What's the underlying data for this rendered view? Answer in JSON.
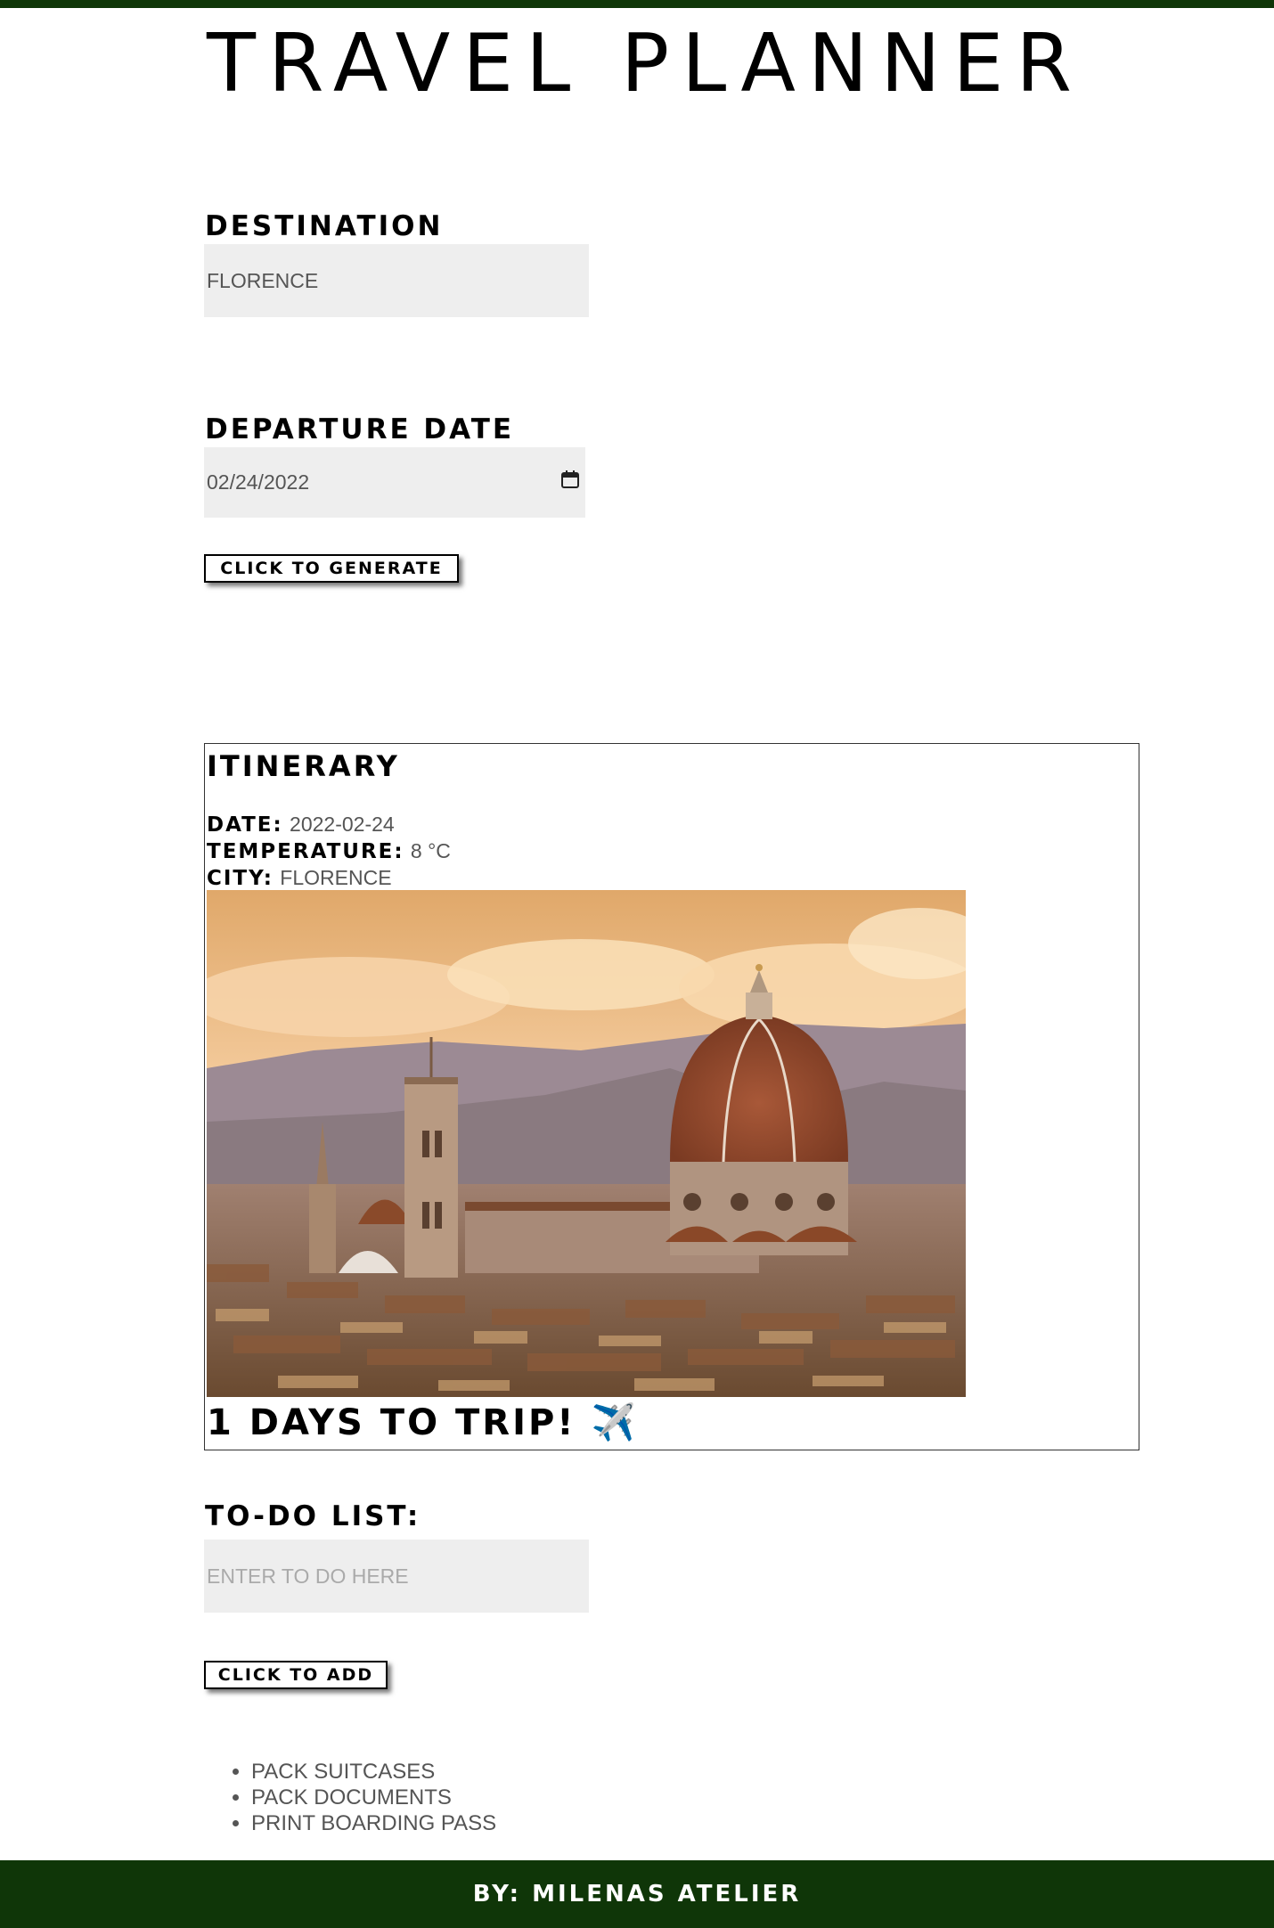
{
  "header": {
    "title": "TRAVEL PLANNER"
  },
  "form": {
    "destination_label": "DESTINATION",
    "destination_value": "FLORENCE",
    "departure_label": "DEPARTURE DATE",
    "departure_value": "02/24/2022",
    "generate_button": "CLICK TO GENERATE"
  },
  "itinerary": {
    "title": "ITINERARY",
    "date_label": "DATE:",
    "date_value": "2022-02-24",
    "temperature_label": "TEMPERATURE:",
    "temperature_value": "8 °C",
    "city_label": "CITY:",
    "city_value": "FLORENCE",
    "countdown": "1 DAYS TO TRIP! ✈️"
  },
  "todo": {
    "label": "TO-DO LIST:",
    "placeholder": "ENTER TO DO HERE",
    "add_button": "CLICK TO ADD",
    "items": [
      "PACK SUITCASES",
      "PACK DOCUMENTS",
      "PRINT BOARDING PASS"
    ]
  },
  "footer": {
    "text": "BY: MILENAS ATELIER"
  },
  "colors": {
    "accent": "#0f3608",
    "field_bg": "#eeeeee"
  },
  "icons": {
    "date_picker": "calendar-icon"
  }
}
